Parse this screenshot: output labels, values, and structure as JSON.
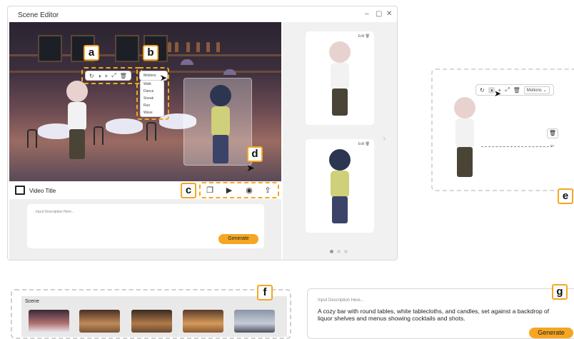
{
  "window": {
    "title": "Scene Editor",
    "controls": {
      "minimize": "–",
      "maximize": "▢",
      "close": "✕"
    }
  },
  "toolbar_labels": {
    "tag_a": "a",
    "tag_b": "b",
    "tag_c": "c",
    "tag_d": "d",
    "tag_e": "e",
    "tag_f": "f",
    "tag_g": "g"
  },
  "stage_toolbar": {
    "icons": [
      "refresh-icon",
      "flip-icon",
      "move-icon",
      "scale-icon",
      "delete-icon"
    ],
    "glyphs": {
      "refresh": "↻",
      "flip": "◑",
      "move": "+",
      "scale": "⤢",
      "delete": "🗑"
    },
    "motions_label": "Motions"
  },
  "motions_menu": {
    "items": [
      "Walk",
      "Dance",
      "Sneak",
      "Run",
      "Wave"
    ]
  },
  "video": {
    "title": "Video Title",
    "controls": {
      "layers": "❐",
      "play": "▶",
      "record": "◉",
      "share": "⇪"
    }
  },
  "description": {
    "placeholder": "Input Description Here...",
    "generate_label": "Generate"
  },
  "character_panel": {
    "cards": [
      {
        "edit_label": "Edit"
      },
      {
        "edit_label": "Edit"
      }
    ],
    "next_arrow": "›"
  },
  "detail_panel": {
    "motions_label": "Motions",
    "glyphs": {
      "refresh": "↻",
      "flip": "◑",
      "move": "+",
      "scale": "⤢",
      "delete": "🗑",
      "handle": "⇔"
    }
  },
  "scene_panel": {
    "title": "Scene"
  },
  "generate_panel": {
    "placeholder": "Input Description Here...",
    "text": "A cozy bar with round tables, white tablecloths, and candles, set against a backdrop of liquor shelves and menus showing cocktails and shots.",
    "generate_label": "Generate"
  },
  "colors": {
    "accent": "#f5a623",
    "panel": "#f1f1f1"
  }
}
